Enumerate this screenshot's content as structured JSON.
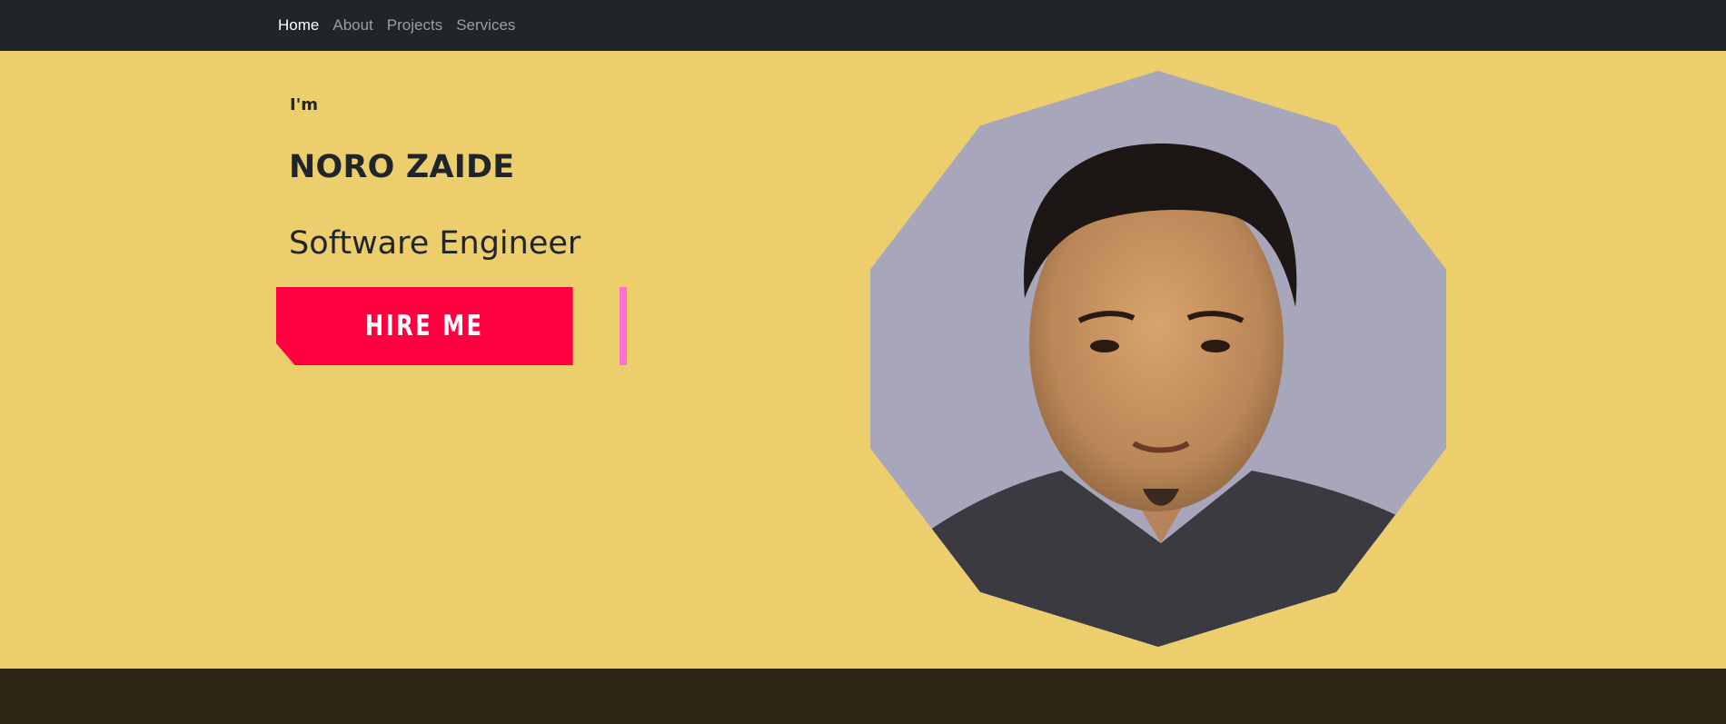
{
  "nav": {
    "items": [
      {
        "label": "Home",
        "active": true
      },
      {
        "label": "About",
        "active": false
      },
      {
        "label": "Projects",
        "active": false
      },
      {
        "label": "Services",
        "active": false
      }
    ]
  },
  "hero": {
    "intro": "I'm",
    "name": "NORO ZAIDE",
    "role": "Software Engineer",
    "cta_label": "HIRE ME",
    "photo_icon": "profile-photo"
  },
  "colors": {
    "navbar": "#212529",
    "hero_background": "#eccf6c",
    "cta": "#ff0040",
    "cta_accent": "#ff6fd1",
    "footer": "#2d2718"
  }
}
